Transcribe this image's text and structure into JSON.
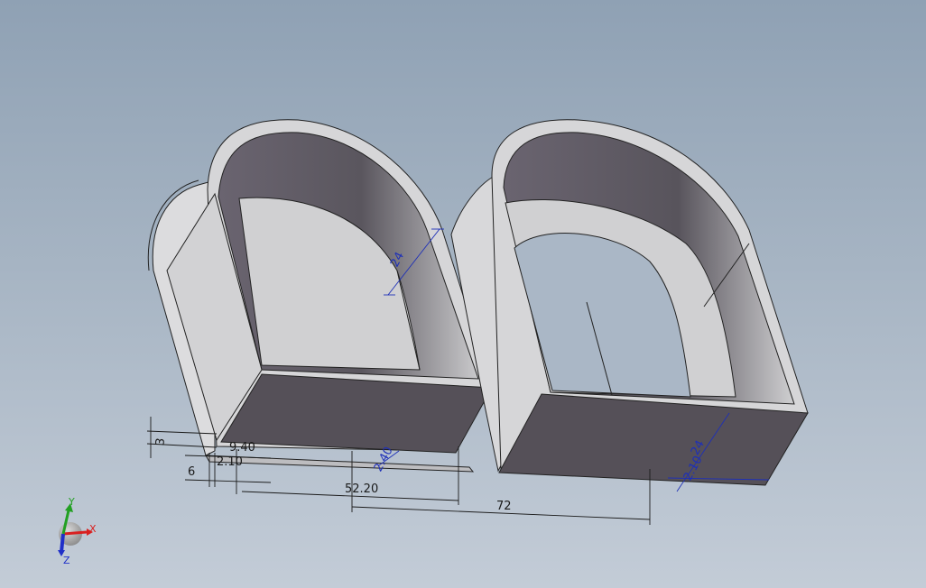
{
  "viewport": {
    "background_top": "#8fa1b4",
    "background_bottom": "#c3ccd7"
  },
  "model": {
    "face_color": "#d4d4d6",
    "dark_face_color": "#5a565c"
  },
  "dimensions": {
    "left_inner_height": "24",
    "left_small_a": "3",
    "left_small_b": "9.40",
    "left_small_c": "6",
    "left_small_d": "2.10",
    "left_thickness": "2.40",
    "left_length": "52.20",
    "total_length": "72",
    "right_height": "24",
    "right_thickness": "2.10"
  },
  "triad": {
    "x_label": "X",
    "y_label": "Y",
    "z_label": "Z",
    "x_color": "#d92020",
    "y_color": "#22a022",
    "z_color": "#2030c8"
  }
}
